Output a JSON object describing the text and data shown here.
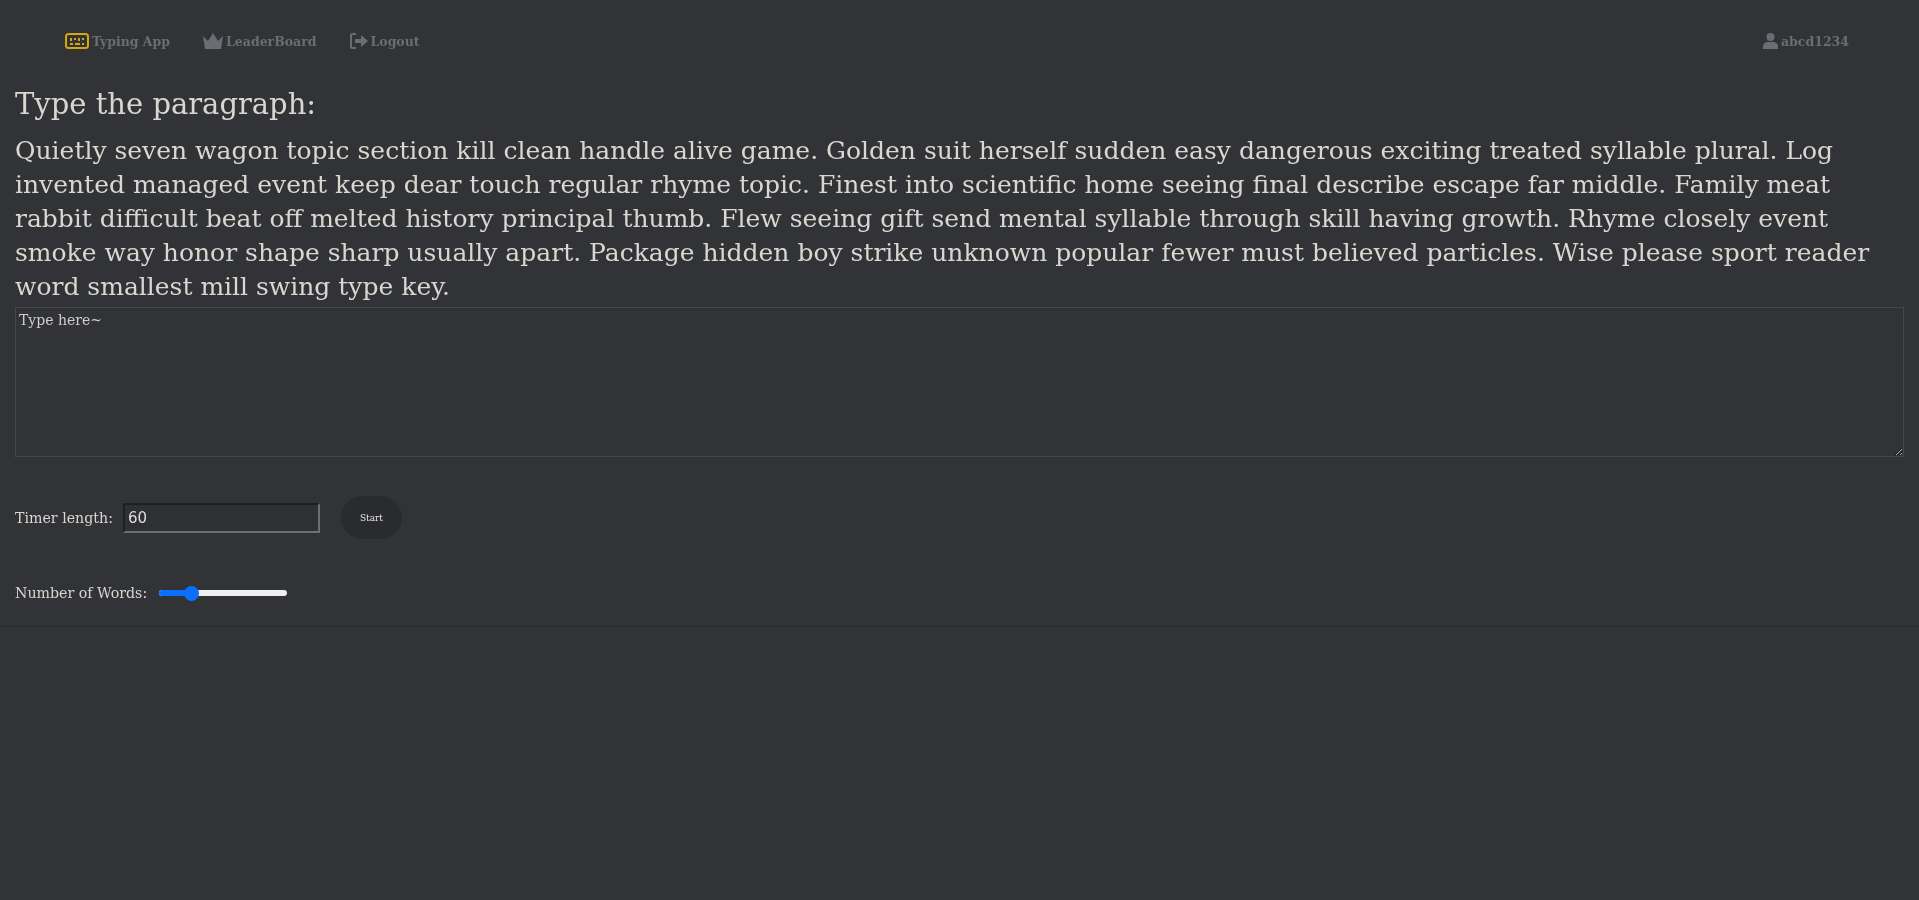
{
  "navbar": {
    "links": [
      {
        "kind": "logo",
        "label": "Typing App"
      },
      {
        "kind": "leaderboard",
        "label": "LeaderBoard"
      },
      {
        "kind": "logout",
        "label": "Logout"
      }
    ],
    "user": {
      "name": "abcd1234"
    }
  },
  "prompt": {
    "heading": "Type the paragraph:",
    "paragraph": "Quietly seven wagon topic section kill clean handle alive game. Golden suit herself sudden easy dangerous exciting treated syllable plural. Log invented managed event keep dear touch regular rhyme topic. Finest into scientific home seeing final describe escape far middle. Family meat rabbit difficult beat off melted history principal thumb. Flew seeing gift send mental syllable through skill having growth. Rhyme closely event smoke way honor shape sharp usually apart. Package hidden boy strike unknown popular fewer must believed particles. Wise please sport reader word smallest mill swing type key."
  },
  "answer": {
    "placeholder": "Type here~"
  },
  "timer": {
    "label": "Timer length:",
    "value": "60",
    "button": "Start"
  },
  "words": {
    "label": "Number of Words:",
    "level": 0.25
  }
}
